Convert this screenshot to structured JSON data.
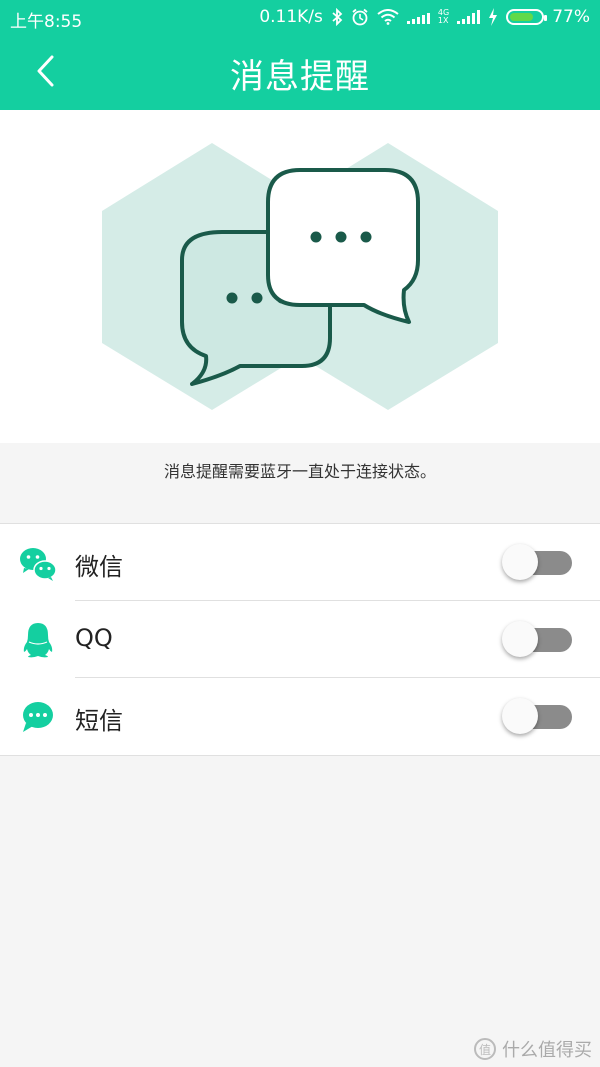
{
  "status_bar": {
    "time": "上午8:55",
    "network_speed": "0.11K/s",
    "net_4g": "4G",
    "net_1x": "1X",
    "battery_percent": "77%",
    "battery_level": 0.77
  },
  "app_bar": {
    "title": "消息提醒",
    "back_icon": "chevron-left-icon"
  },
  "hero": {
    "illustration": "chat-bubbles-illustration",
    "hexagon_color": "#d5ece7",
    "outline_color": "#1a5a4a"
  },
  "hint_text": "消息提醒需要蓝牙一直处于连接状态。",
  "notification_apps": [
    {
      "label": "微信",
      "icon": "wechat-icon",
      "enabled": false
    },
    {
      "label": "QQ",
      "icon": "qq-icon",
      "enabled": false
    },
    {
      "label": "短信",
      "icon": "sms-icon",
      "enabled": false
    }
  ],
  "watermark": "什么值得买",
  "colors": {
    "accent": "#14cfa0",
    "toggle_off": "#8b8b8b"
  }
}
